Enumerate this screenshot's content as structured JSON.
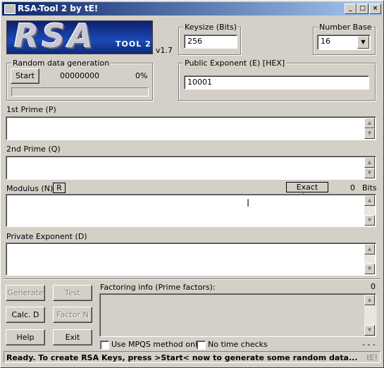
{
  "window": {
    "title": "RSA-Tool 2 by tE!",
    "minimize": "_",
    "maximize": "□",
    "close": "×"
  },
  "logo": {
    "big": "RSA",
    "small": "TOOL 2"
  },
  "version": "v1.7",
  "keysize": {
    "label": "Keysize (Bits)",
    "value": "256"
  },
  "number_base": {
    "label": "Number Base",
    "value": "16"
  },
  "random": {
    "label": "Random data generation",
    "start": "Start",
    "counter": "00000000",
    "percent": "0%",
    "progress": 0
  },
  "public_exponent": {
    "label": "Public Exponent (E) [HEX]",
    "value": "10001"
  },
  "prime_p": {
    "label": "1st Prime (P)"
  },
  "prime_q": {
    "label": "2nd Prime (Q)"
  },
  "modulus": {
    "label": "Modulus (N)",
    "r_button": "R",
    "exact_size": "Exact size:",
    "size_value": "0",
    "bits": "Bits"
  },
  "private_exponent": {
    "label": "Private Exponent (D)"
  },
  "buttons": {
    "generate": "Generate",
    "test": "Test",
    "calc_d": "Calc. D",
    "factor_n": "Factor N",
    "help": "Help",
    "exit": "Exit"
  },
  "factoring": {
    "label": "Factoring info (Prime factors):",
    "count": "0"
  },
  "options": {
    "mpqs": "Use MPQS method only",
    "no_time": "No time checks",
    "dashes": "- - -"
  },
  "status": {
    "text": "Ready. To create RSA Keys, press >Start< now to generate some random data...",
    "corner": "tE!"
  },
  "icons": {
    "cursor": "text-cursor-icon"
  }
}
